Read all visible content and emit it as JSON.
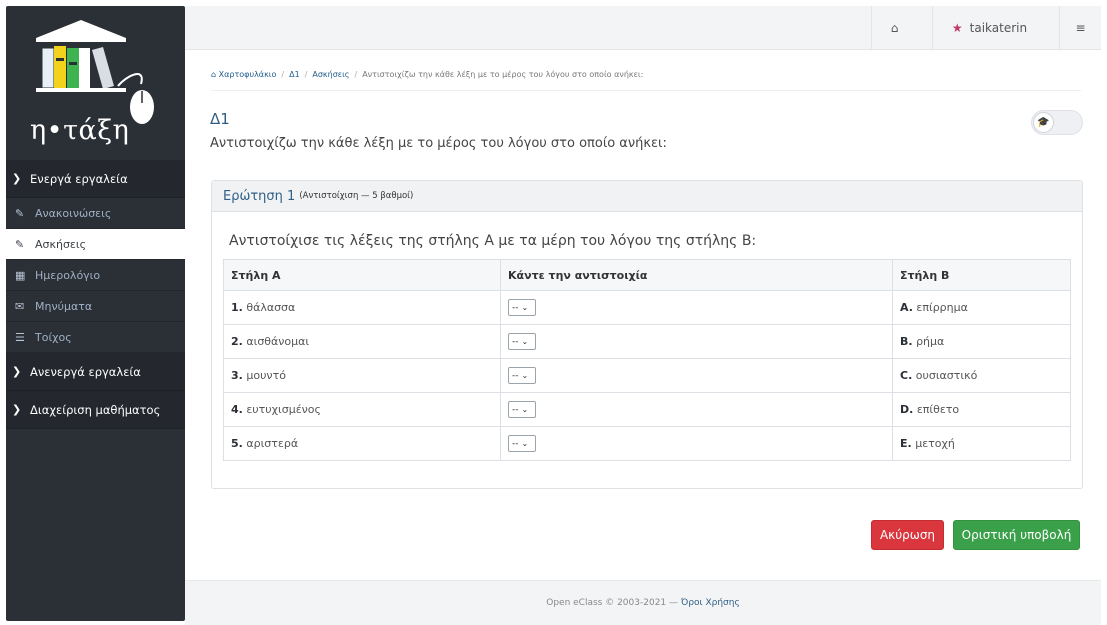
{
  "sidebar": {
    "logo_text": "η•τάξη",
    "sections": {
      "active_tools": "Ενεργά εργαλεία",
      "inactive_tools": "Ανενεργά εργαλεία",
      "course_admin": "Διαχείριση μαθήματος"
    },
    "items": [
      {
        "label": "Ανακοινώσεις",
        "icon": "megaphone-icon"
      },
      {
        "label": "Ασκήσεις",
        "icon": "pencil-square-icon",
        "active": true
      },
      {
        "label": "Ημερολόγιο",
        "icon": "calendar-icon"
      },
      {
        "label": "Μηνύματα",
        "icon": "envelope-icon"
      },
      {
        "label": "Τοίχος",
        "icon": "list-icon"
      }
    ]
  },
  "topbar": {
    "username": "taikaterin"
  },
  "breadcrumb": {
    "items": [
      "Χαρτοφυλάκιο",
      "Δ1",
      "Ασκήσεις"
    ],
    "current": "Αντιστοιχίζω την κάθε λέξη με το μέρος του λόγου στο οποίο ανήκει:"
  },
  "page": {
    "title": "Δ1",
    "description": "Αντιστοιχίζω την κάθε λέξη με το μέρος του λόγου στο οποίο ανήκει:"
  },
  "question": {
    "heading": "Ερώτηση 1",
    "meta": "(Αντιστοίχιση — 5 βαθμοί)",
    "text": "Αντιστοίχισε τις λέξεις της στήλης A με τα μέρη του λόγου της στήλης B:",
    "columns": [
      "Στήλη A",
      "Κάντε την αντιστοιχία",
      "Στήλη B"
    ],
    "rows": [
      {
        "a_num": "1.",
        "a_text": "θάλασσα",
        "select": "--",
        "b_num": "A.",
        "b_text": "επίρρημα"
      },
      {
        "a_num": "2.",
        "a_text": "αισθάνομαι",
        "select": "--",
        "b_num": "B.",
        "b_text": "ρήμα"
      },
      {
        "a_num": "3.",
        "a_text": "μουντό",
        "select": "--",
        "b_num": "C.",
        "b_text": "ουσιαστικό"
      },
      {
        "a_num": "4.",
        "a_text": "ευτυχισμένος",
        "select": "--",
        "b_num": "D.",
        "b_text": "επίθετο"
      },
      {
        "a_num": "5.",
        "a_text": "αριστερά",
        "select": "--",
        "b_num": "E.",
        "b_text": "μετοχή"
      }
    ]
  },
  "buttons": {
    "cancel": "Ακύρωση",
    "submit": "Οριστική υποβολή"
  },
  "footer": {
    "text": "Open eClass © 2003-2021 —",
    "link": "Όροι Χρήσης"
  },
  "colors": {
    "sidebar_bg": "#2b2f36",
    "accent_blue": "#2f5f86",
    "cancel_red": "#d9363e",
    "submit_green": "#3aa14a"
  }
}
